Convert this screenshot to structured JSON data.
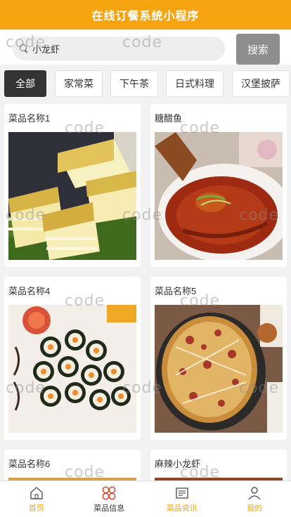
{
  "app": {
    "title": "在线订餐系统小程序"
  },
  "search": {
    "value": "小龙虾",
    "button_label": "搜索"
  },
  "categories": [
    {
      "label": "全部",
      "active": true
    },
    {
      "label": "家常菜",
      "active": false
    },
    {
      "label": "下午茶",
      "active": false
    },
    {
      "label": "日式料理",
      "active": false
    },
    {
      "label": "汉堡披萨",
      "active": false
    }
  ],
  "dishes": [
    {
      "name": "菜品名称1",
      "icon": "mille-crepe-cake-photo"
    },
    {
      "name": "糖醋鱼",
      "icon": "sweet-sour-fish-photo"
    },
    {
      "name": "菜品名称4",
      "icon": "sushi-roll-photo"
    },
    {
      "name": "菜品名称5",
      "icon": "pizza-photo"
    },
    {
      "name": "菜品名称6",
      "icon": "dish-photo"
    },
    {
      "name": "麻辣小龙虾",
      "icon": "spicy-crayfish-photo"
    }
  ],
  "watermark": "code",
  "tabbar": [
    {
      "label": "首页",
      "icon": "home-icon",
      "active": false
    },
    {
      "label": "菜品信息",
      "icon": "grid-flower-icon",
      "active": true
    },
    {
      "label": "菜品资讯",
      "icon": "news-icon",
      "active": false
    },
    {
      "label": "我的",
      "icon": "user-icon",
      "active": false
    }
  ],
  "colors": {
    "accent": "#f5a410",
    "search_button": "#8e8e8e",
    "active_category": "#333333"
  }
}
